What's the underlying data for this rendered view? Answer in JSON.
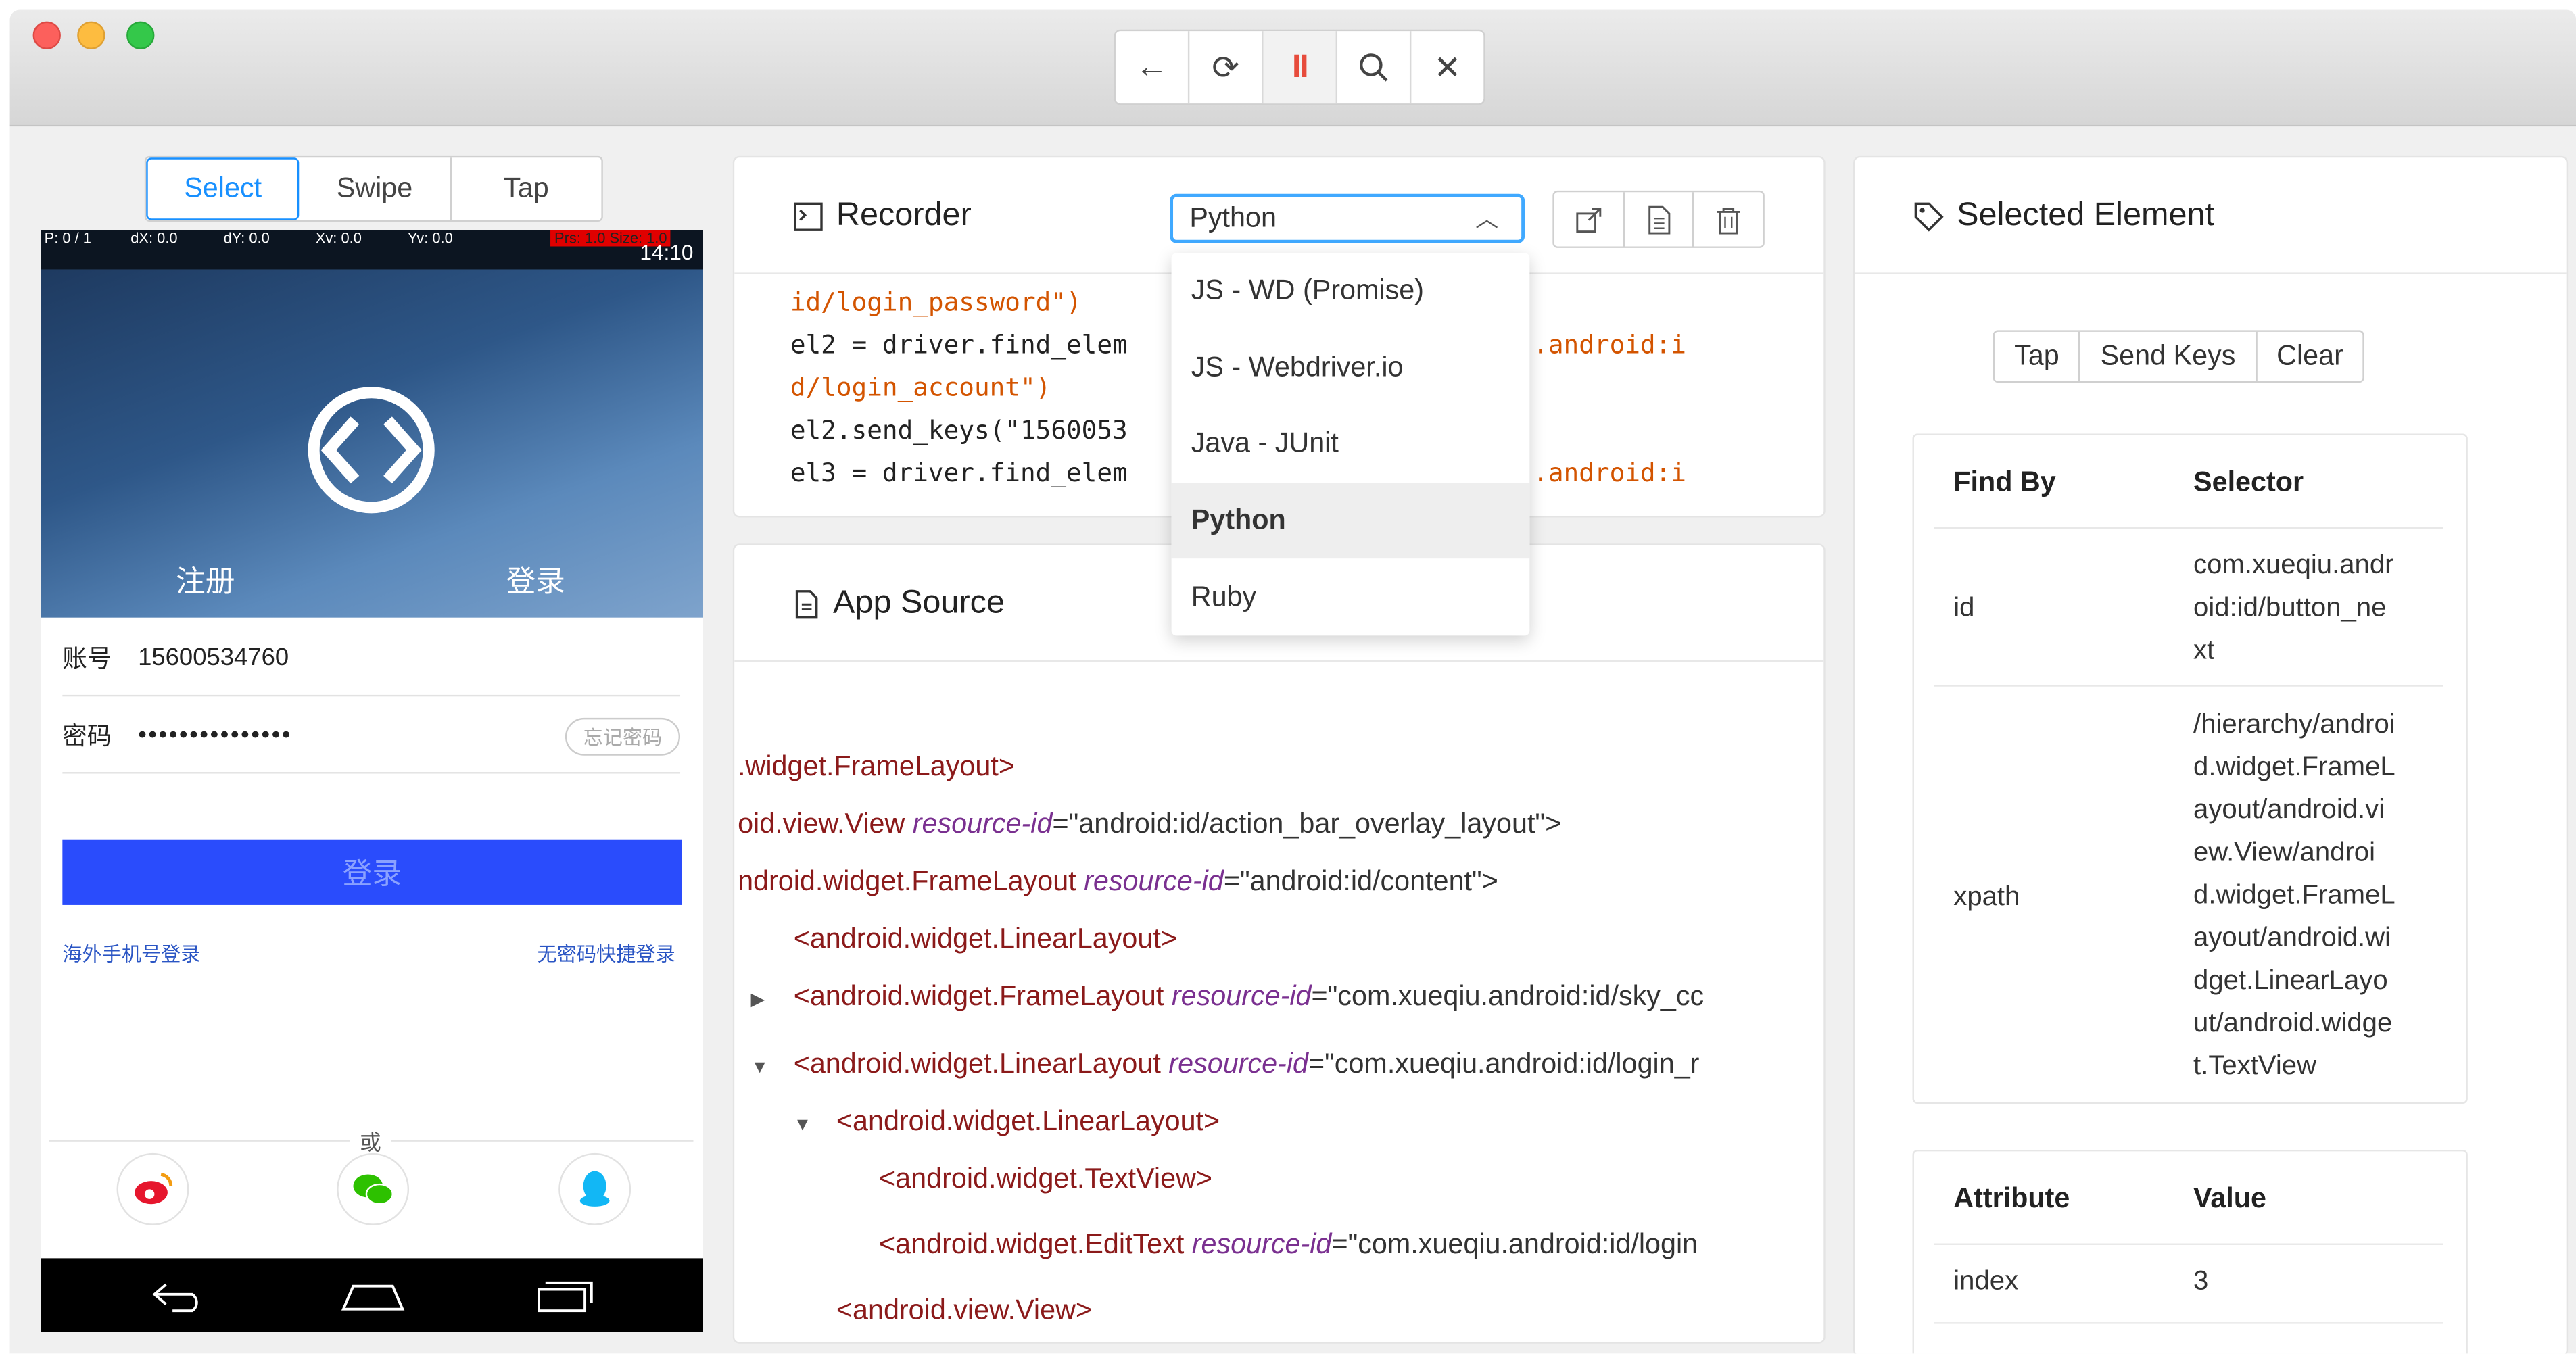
{
  "toolbar": {
    "buttons": [
      {
        "name": "back-icon",
        "glyph": "←"
      },
      {
        "name": "refresh-icon",
        "glyph": "⟳"
      },
      {
        "name": "pause-icon",
        "glyph": "II"
      },
      {
        "name": "search-icon",
        "glyph": "⌕"
      },
      {
        "name": "close-icon",
        "glyph": "✕"
      }
    ]
  },
  "modes": [
    "Select",
    "Swipe",
    "Tap"
  ],
  "phone": {
    "status_info": [
      "P: 0 / 1",
      "dX: 0.0",
      "dY: 0.0",
      "Xv: 0.0",
      "Yv: 0.0"
    ],
    "status_prs": "Prs: 1.0   Size: 1.0",
    "time": "14:10",
    "tab_register": "注册",
    "tab_login": "登录",
    "account_label": "账号",
    "account_value": "15600534760",
    "password_label": "密码",
    "password_value": "•••••••••••••••",
    "forget": "忘记密码",
    "login_button": "登录",
    "overseas_link": "海外手机号登录",
    "nopwd_link": "无密码快捷登录",
    "or": "或"
  },
  "recorder": {
    "title": "Recorder",
    "language": "Python",
    "code_lines": [
      {
        "a": "id/login_password\")",
        "b": ""
      },
      {
        "a": "el2 = driver.find_elem",
        "b": ".android:i"
      },
      {
        "a": "d/login_account\")",
        "b": ""
      },
      {
        "a": "el2.send_keys(\"1560053",
        "b": ""
      },
      {
        "a": "el3 = driver.find_elem",
        "b": ".android:i"
      }
    ],
    "languages": [
      "JS - WD (Promise)",
      "JS - Webdriver.io",
      "Java - JUnit",
      "Python",
      "Ruby"
    ]
  },
  "source": {
    "title": "App Source",
    "nodes": [
      {
        "indent": 0,
        "tri": "",
        "tag": ".widget.FrameLayout>",
        "attr": "",
        "val": ""
      },
      {
        "indent": 0,
        "tri": "",
        "tag": "oid.view.View ",
        "attr": "resource-id",
        "val": "=\"android:id/action_bar_overlay_layout\">"
      },
      {
        "indent": 0,
        "tri": "",
        "tag": "ndroid.widget.FrameLayout ",
        "attr": "resource-id",
        "val": "=\"android:id/content\">"
      },
      {
        "indent": 1,
        "tri": "",
        "tag": "<android.widget.LinearLayout>",
        "attr": "",
        "val": ""
      },
      {
        "indent": 1,
        "tri": "▶",
        "tag": "<android.widget.FrameLayout ",
        "attr": "resource-id",
        "val": "=\"com.xueqiu.android:id/sky_cc"
      },
      {
        "indent": 1,
        "tri": "▼",
        "tag": "<android.widget.LinearLayout ",
        "attr": "resource-id",
        "val": "=\"com.xueqiu.android:id/login_r"
      },
      {
        "indent": 2,
        "tri": "▼",
        "tag": "<android.widget.LinearLayout>",
        "attr": "",
        "val": ""
      },
      {
        "indent": 3,
        "tri": "",
        "tag": "<android.widget.TextView>",
        "attr": "",
        "val": ""
      },
      {
        "indent": 3,
        "tri": "",
        "tag": "<android.widget.EditText ",
        "attr": "resource-id",
        "val": "=\"com.xueqiu.android:id/login"
      },
      {
        "indent": 2,
        "tri": "",
        "tag": "<android.view.View>",
        "attr": "",
        "val": ""
      }
    ]
  },
  "selected": {
    "title": "Selected Element",
    "actions": [
      "Tap",
      "Send Keys",
      "Clear"
    ],
    "findby_header": "Find By",
    "selector_header": "Selector",
    "rows": [
      {
        "by": "id",
        "sel": [
          "com.xueqiu.andr",
          "oid:id/button_ne",
          "xt"
        ]
      },
      {
        "by": "xpath",
        "sel": [
          "/hierarchy/androi",
          "d.widget.FrameL",
          "ayout/android.vi",
          "ew.View/androi",
          "d.widget.FrameL",
          "ayout/android.wi",
          "dget.LinearLayo",
          "ut/android.widge",
          "t.TextView"
        ]
      }
    ],
    "attr_header": "Attribute",
    "value_header": "Value",
    "attr_rows": [
      {
        "name": "index",
        "value": "3"
      }
    ]
  }
}
